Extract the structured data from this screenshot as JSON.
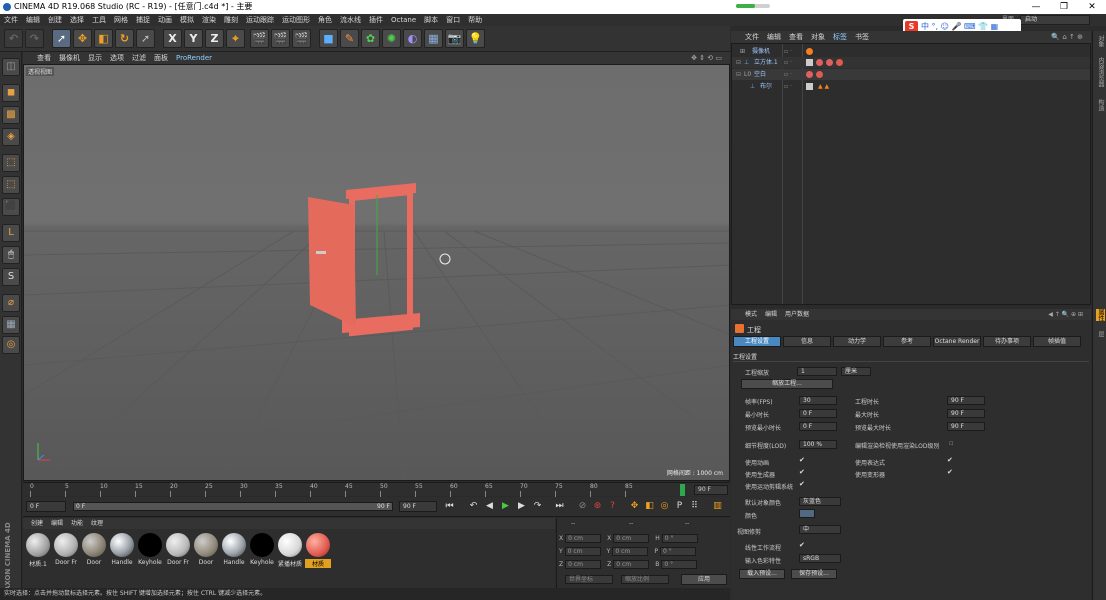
{
  "window": {
    "title": "CINEMA 4D R19.068 Studio (RC - R19) - [任意门.c4d *] - 主要",
    "buttons": {
      "minimize": "—",
      "maximize": "❐",
      "close": "✕"
    }
  },
  "menubar": [
    "文件",
    "编辑",
    "创建",
    "选择",
    "工具",
    "网格",
    "捕捉",
    "动画",
    "模拟",
    "渲染",
    "雕刻",
    "运动跟踪",
    "运动图形",
    "角色",
    "流水线",
    "插件",
    "Octane",
    "脚本",
    "窗口",
    "帮助"
  ],
  "layout": {
    "label": "界面",
    "value": "启动"
  },
  "ime_bar": {
    "logo": "S",
    "text": "中 °, ☺ 🎤 ⌨ 👕 ▦"
  },
  "viewport": {
    "menu": [
      "查看",
      "摄像机",
      "显示",
      "选项",
      "过滤",
      "面板",
      "ProRender"
    ],
    "highlighted_menu": "ProRender",
    "label": "透视视图",
    "grid_distance": "网格间距 : 1000 cm"
  },
  "timeline": {
    "ticks": [
      "0",
      "5",
      "10",
      "15",
      "20",
      "25",
      "30",
      "35",
      "40",
      "45",
      "50",
      "55",
      "60",
      "65",
      "70",
      "75",
      "80",
      "85",
      "90"
    ],
    "current_frame": "90 F",
    "start_field": "0 F",
    "offset_field": "0 F",
    "end_field": "90 F",
    "end_field2": "90 F"
  },
  "material_manager": {
    "menu": [
      "创建",
      "编辑",
      "功能",
      "纹理"
    ],
    "materials": [
      {
        "name": "材质.1",
        "color": "#a0a0a0"
      },
      {
        "name": "Door Fr",
        "color": "#b0b0b0"
      },
      {
        "name": "Door",
        "color": "#8a8070"
      },
      {
        "name": "Handle",
        "color": "#9aa0a8"
      },
      {
        "name": "Keyhole",
        "color": "#000000"
      },
      {
        "name": "Door Fr",
        "color": "#b8b8b8"
      },
      {
        "name": "Door",
        "color": "#908878"
      },
      {
        "name": "Handle",
        "color": "#a0a6ae"
      },
      {
        "name": "Keyhole",
        "color": "#000000"
      },
      {
        "name": "紧播材质",
        "color": "#d8d8d8"
      },
      {
        "name": "材质",
        "color": "#e05a50"
      }
    ],
    "brand": "MAXON CINEMA 4D"
  },
  "coordinates": {
    "headers": [
      "--",
      "--",
      "--"
    ],
    "rows": [
      {
        "a": "X",
        "av": "0 cm",
        "b": "X",
        "bv": "0 cm",
        "c": "H",
        "cv": "0 °"
      },
      {
        "a": "Y",
        "av": "0 cm",
        "b": "Y",
        "bv": "0 cm",
        "c": "P",
        "cv": "0 °"
      },
      {
        "a": "Z",
        "av": "0 cm",
        "b": "Z",
        "bv": "0 cm",
        "c": "B",
        "cv": "0 °"
      }
    ],
    "world": "世界坐标",
    "scale": "缩放比例",
    "apply": "应用"
  },
  "object_manager": {
    "menu": [
      "文件",
      "编辑",
      "查看",
      "对象",
      "标签",
      "书签"
    ],
    "highlighted_menu": "标签",
    "objects": [
      "摄像机",
      "立方体.1",
      "空白",
      "布尔"
    ]
  },
  "attribute_manager": {
    "menu": [
      "模式",
      "编辑",
      "用户数据"
    ],
    "title": "工程",
    "tabs": [
      "工程设置",
      "信息",
      "动力学",
      "参考",
      "Octane Render",
      "待办事项",
      "帧插值"
    ],
    "section": "工程设置",
    "scale_label": "工程缩放",
    "scale_value": "1",
    "scale_unit": "厘米",
    "scale_button": "缩放工程...",
    "fps_label": "帧率(FPS)",
    "fps_value": "30",
    "project_time_label": "工程时长",
    "project_time_value": "90 F",
    "min_time_label": "最小时长",
    "min_time_value": "0 F",
    "max_time_label": "最大时长",
    "max_time_value": "90 F",
    "preview_min_label": "预览最小时长",
    "preview_min_value": "0 F",
    "preview_max_label": "预览最大时长",
    "preview_max_value": "90 F",
    "lod_label": "细节程度(LOD)",
    "lod_value": "100 %",
    "render_lod_label": "编辑渲染检视使用渲染LOD级别",
    "use_anim_label": "使用动画",
    "use_expr_label": "使用表达式",
    "use_gen_label": "使用生成器",
    "use_deform_label": "使用变形器",
    "use_motion_label": "使用运动剪辑系统",
    "default_color_label": "默认对象颜色",
    "default_color_value": "灰蓝色",
    "color_label": "颜色",
    "view_clip_label": "视图修剪",
    "view_clip_value": "中",
    "linear_label": "线性工作流程",
    "input_color_label": "输入色彩特性",
    "input_color_value": "sRGB",
    "load_preset": "载入预设...",
    "save_preset": "保存预设..."
  },
  "right_strip": [
    "对象",
    "内容浏览器",
    "构造",
    "属性",
    "层"
  ],
  "status": "实时选择：点击并拖动鼠标选择元素。按住 SHIFT 键增加选择元素；按住 CTRL 键减少选择元素。"
}
